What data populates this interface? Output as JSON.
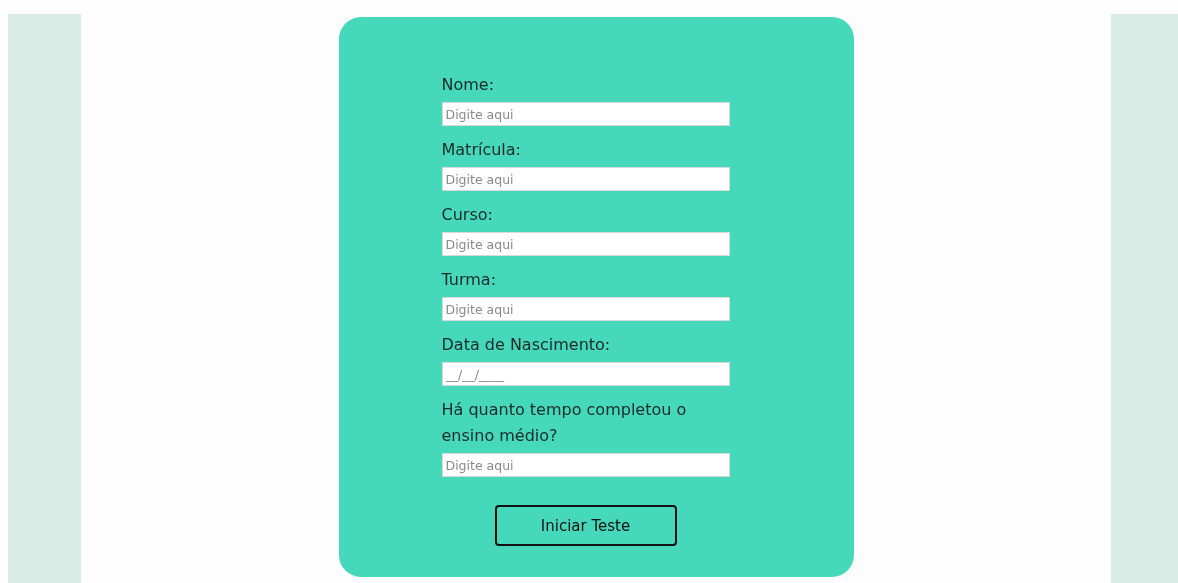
{
  "form": {
    "fields": [
      {
        "label": "Nome:",
        "placeholder": "Digite aqui"
      },
      {
        "label": "Matrícula:",
        "placeholder": "Digite aqui"
      },
      {
        "label": "Curso:",
        "placeholder": "Digite aqui"
      },
      {
        "label": "Turma:",
        "placeholder": "Digite aqui"
      },
      {
        "label": "Data de Nascimento:",
        "placeholder": "__/__/____"
      },
      {
        "label": "Há quanto tempo completou o ensino médio?",
        "placeholder": "Digite aqui"
      }
    ],
    "submit_button": "Iniciar Teste"
  }
}
